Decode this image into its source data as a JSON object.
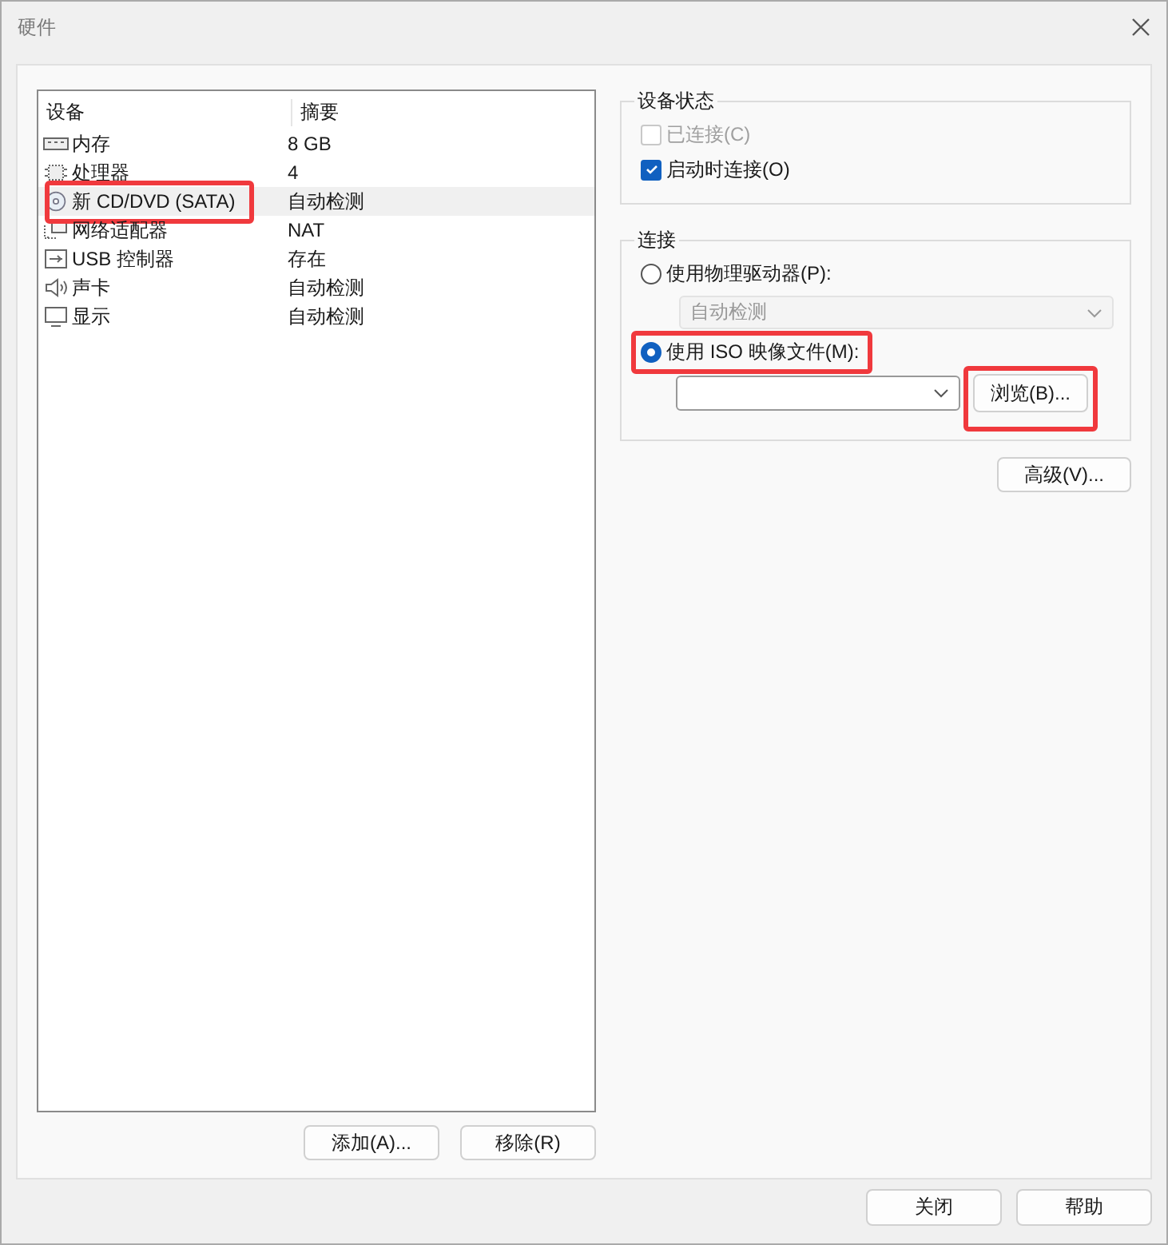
{
  "window": {
    "title": "硬件"
  },
  "device_list": {
    "columns": [
      "设备",
      "摘要"
    ],
    "rows": [
      {
        "kind": "memory",
        "device": "内存",
        "summary": "8 GB",
        "selected": false,
        "highlighted": false
      },
      {
        "kind": "cpu",
        "device": "处理器",
        "summary": "4",
        "selected": false,
        "highlighted": false
      },
      {
        "kind": "cd",
        "device": "新 CD/DVD (SATA)",
        "summary": "自动检测",
        "selected": true,
        "highlighted": true
      },
      {
        "kind": "network",
        "device": "网络适配器",
        "summary": "NAT",
        "selected": false,
        "highlighted": false
      },
      {
        "kind": "usb",
        "device": "USB 控制器",
        "summary": "存在",
        "selected": false,
        "highlighted": false
      },
      {
        "kind": "sound",
        "device": "声卡",
        "summary": "自动检测",
        "selected": false,
        "highlighted": false
      },
      {
        "kind": "display",
        "device": "显示",
        "summary": "自动检测",
        "selected": false,
        "highlighted": false
      }
    ]
  },
  "device_status": {
    "title": "设备状态",
    "options": [
      {
        "label": "已连接(C)",
        "checked": false,
        "disabled": true
      },
      {
        "label": "启动时连接(O)",
        "checked": true,
        "disabled": false
      }
    ]
  },
  "connection": {
    "title": "连接",
    "physical": {
      "label": "使用物理驱动器(P):",
      "selected": false,
      "drive": {
        "value": "自动检测",
        "disabled": true
      }
    },
    "iso": {
      "label": "使用 ISO 映像文件(M):",
      "selected": true,
      "highlighted": true,
      "browse": {
        "label": "浏览(B)...",
        "highlighted": true
      }
    }
  },
  "advanced_button": "高级(V)...",
  "list_buttons": [
    "添加(A)...",
    "移除(R)"
  ],
  "footer_buttons": [
    "关闭",
    "帮助"
  ]
}
